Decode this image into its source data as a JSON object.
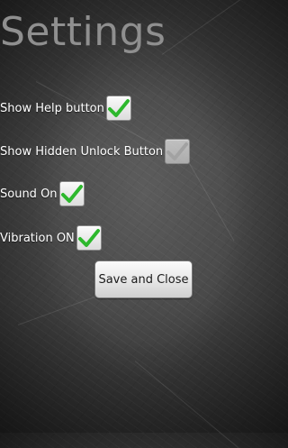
{
  "page": {
    "title": "Settings"
  },
  "settings": [
    {
      "label": "Show Help button",
      "checked": true,
      "enabled": true
    },
    {
      "label": "Show Hidden Unlock Button",
      "checked": true,
      "enabled": false
    },
    {
      "label": "Sound On",
      "checked": true,
      "enabled": true
    },
    {
      "label": "Vibration ON",
      "checked": true,
      "enabled": true
    }
  ],
  "actions": {
    "save_label": "Save and Close"
  },
  "colors": {
    "check_active": "#2db82d",
    "check_disabled": "#bcbcbc"
  },
  "icons": {
    "checkbox": "checkmark-icon"
  }
}
